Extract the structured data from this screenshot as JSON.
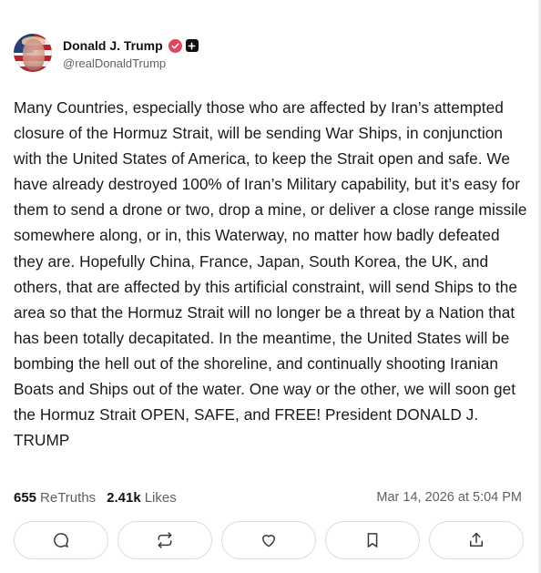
{
  "post": {
    "author": {
      "display_name": "Donald J. Trump",
      "handle": "@realDonaldTrump"
    },
    "text": "Many Countries, especially those who are affected by Iran’s attempted closure of the Hormuz Strait, will be sending War Ships, in conjunction with the United States of America, to keep the Strait open and safe. We have already destroyed 100% of Iran’s Military capability, but it’s easy for them to send a drone or two, drop a mine, or deliver a close range missile somewhere along, or in, this Waterway, no matter how badly defeated they are. Hopefully China, France, Japan, South Korea, the UK, and others, that are affected by this artificial constraint, will send Ships to the area so that the Hormuz Strait will no longer be a threat by a Nation that has been totally decapitated. In the meantime, the United States will be bombing the hell out of the shoreline, and continually shooting Iranian Boats and Ships out of the water. One way or the other, we will soon get the Hormuz Strait OPEN, SAFE, and FREE! President DONALD J. TRUMP",
    "stats": {
      "retruths_count": "655",
      "retruths_label": "ReTruths",
      "likes_count": "2.41k",
      "likes_label": "Likes"
    },
    "timestamp": "Mar 14, 2026 at 5:04 PM"
  },
  "icons": {
    "verified": "verified-badge-icon",
    "plus": "plus-square-icon",
    "actions": [
      "comment-icon",
      "retruth-icon",
      "heart-icon",
      "bookmark-icon",
      "share-icon"
    ]
  },
  "colors": {
    "verified_badge": "#e0455d",
    "button_border": "#dcdce0",
    "secondary_text": "#5f5f66"
  }
}
